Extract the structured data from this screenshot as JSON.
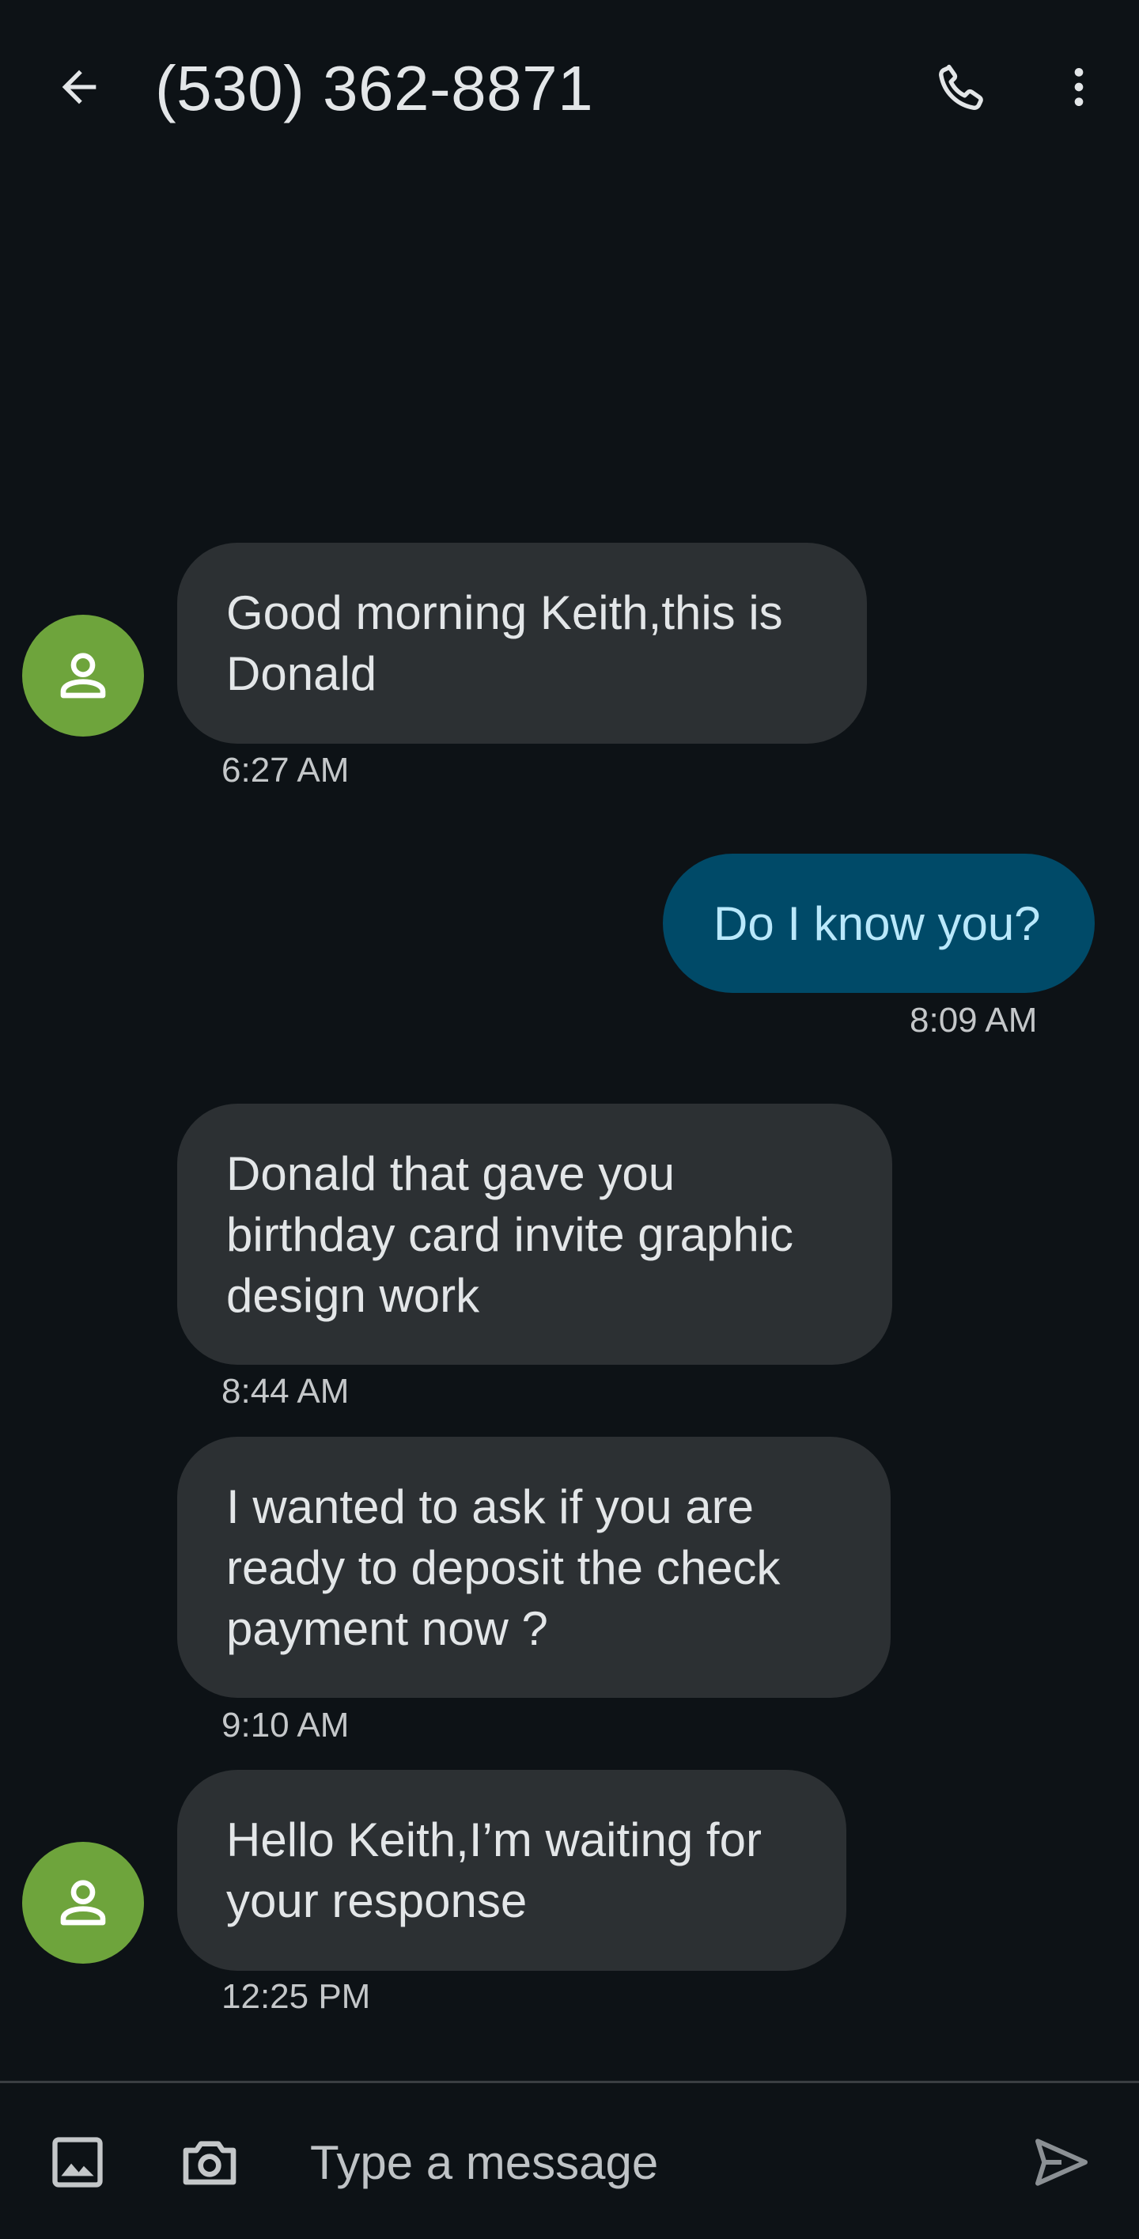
{
  "header": {
    "title": "(530) 362-8871",
    "back_icon": "arrow-back-icon",
    "call_icon": "phone-icon",
    "more_icon": "more-vert-icon"
  },
  "colors": {
    "background": "#0d1216",
    "incoming_bubble": "#2c3033",
    "outgoing_bubble": "#004a68",
    "outgoing_text": "#b9e8fb",
    "avatar": "#6ea43c"
  },
  "messages": [
    {
      "direction": "incoming",
      "text": "Good morning Keith,this is Donald",
      "time": "6:27 AM"
    },
    {
      "direction": "outgoing",
      "text": "Do I know you?",
      "time": "8:09 AM"
    },
    {
      "direction": "incoming",
      "text": "Donald that gave you birthday card invite graphic design work",
      "time": "8:44 AM"
    },
    {
      "direction": "incoming",
      "text": "I wanted to ask if you are ready  to deposit the check payment now ?",
      "time": "9:10 AM"
    },
    {
      "direction": "incoming",
      "text": "Hello Keith,I’m waiting for your response",
      "time": "12:25 PM"
    }
  ],
  "composer": {
    "placeholder": "Type a message",
    "gallery_icon": "image-icon",
    "camera_icon": "camera-icon",
    "send_icon": "send-icon"
  }
}
